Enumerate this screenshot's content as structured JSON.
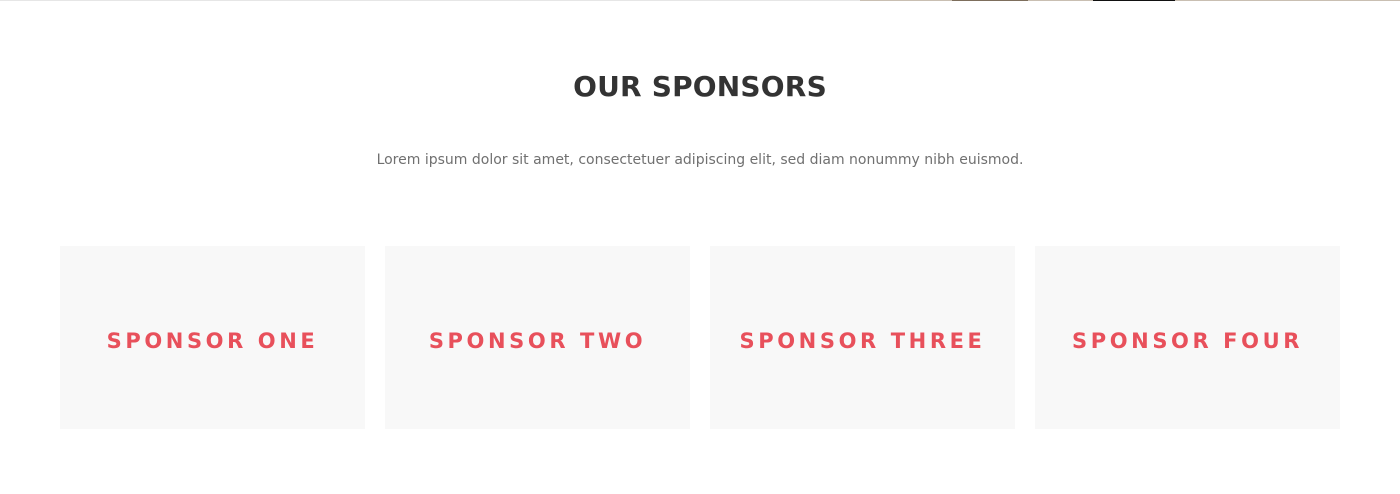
{
  "section": {
    "title": "OUR SPONSORS",
    "subtitle": "Lorem ipsum dolor sit amet, consectetuer adipiscing elit, sed diam nonummy nibh euismod."
  },
  "sponsors": [
    {
      "label": "SPONSOR ONE"
    },
    {
      "label": "SPONSOR TWO"
    },
    {
      "label": "SPONSOR THREE"
    },
    {
      "label": "SPONSOR FOUR"
    }
  ],
  "colors": {
    "accent": "#e8505b",
    "card_bg": "#f8f8f8",
    "title": "#333333",
    "text": "#707070"
  }
}
